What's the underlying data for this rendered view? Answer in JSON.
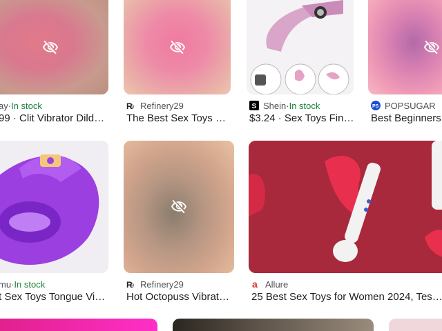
{
  "results": [
    {
      "source": "ay",
      "sep": " · ",
      "stock": "In stock",
      "title": "99 · Clit Vibrator Dild…",
      "colors": {
        "thumb": "#d9788f"
      }
    },
    {
      "source": "Refinery29",
      "title": "The Best Sex Toys …",
      "icon": "refinery29-logo-icon"
    },
    {
      "source": "Shein",
      "sep": " · ",
      "stock": "In stock",
      "title": "$3.24 · Sex Toys Fin…",
      "icon": "shein-logo-icon"
    },
    {
      "source": "POPSUGAR",
      "title": "Best Beginners",
      "icon": "popsugar-logo-icon"
    },
    {
      "source": "mu",
      "sep": " · ",
      "stock": "In stock",
      "title": "t Sex Toys Tongue Vi…"
    },
    {
      "source": "Refinery29",
      "title": "Hot Octopuss Vibrat…",
      "icon": "refinery29-logo-icon"
    },
    {
      "source": "Allure",
      "title": "25 Best Sex Toys for Women 2024, Tes…",
      "icon": "allure-logo-icon"
    }
  ],
  "colors": {
    "in_stock": "#188038",
    "source_text": "#4d5156",
    "title_text": "#202124"
  }
}
